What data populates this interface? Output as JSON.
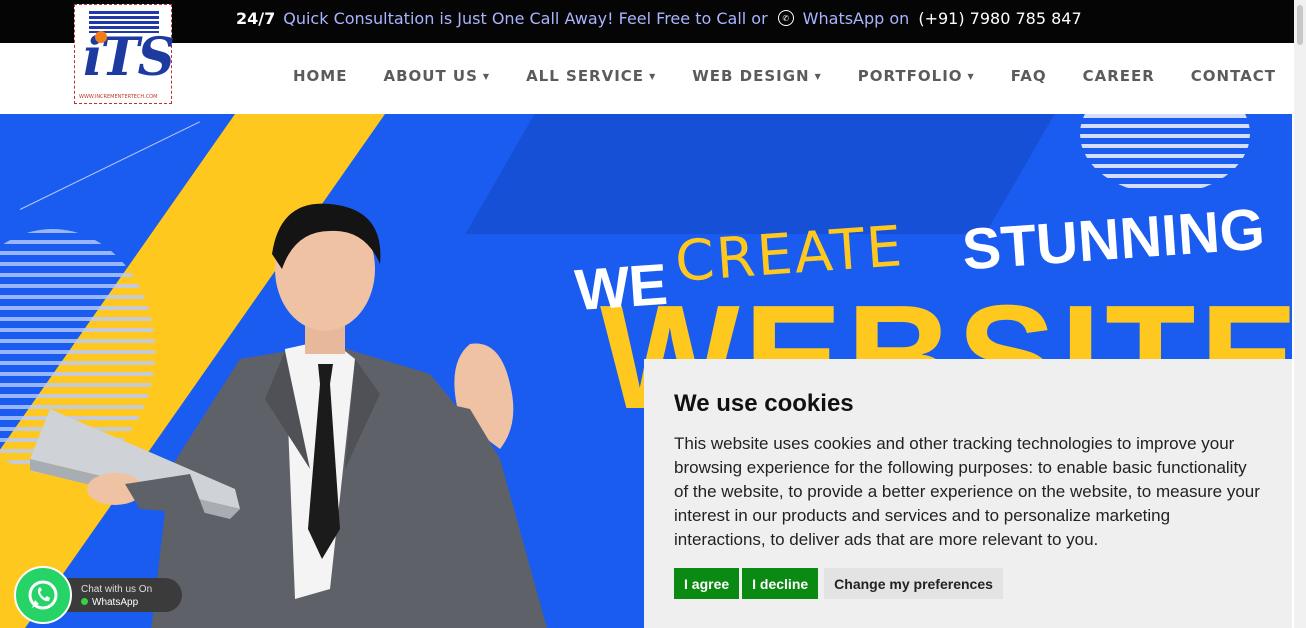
{
  "topbar": {
    "hours": "24/7",
    "message": "Quick Consultation is Just One Call Away! Feel Free to Call or",
    "whatsapp_label": "WhatsApp on",
    "phone": "(+91) 7980 785 847"
  },
  "logo": {
    "letters": "iTS",
    "tagline": "WWW.INCREMENTERTECH.COM"
  },
  "nav": {
    "items": [
      {
        "label": "HOME",
        "dropdown": false
      },
      {
        "label": "ABOUT US",
        "dropdown": true
      },
      {
        "label": "ALL SERVICE",
        "dropdown": true
      },
      {
        "label": "WEB DESIGN",
        "dropdown": true
      },
      {
        "label": "PORTFOLIO",
        "dropdown": true
      },
      {
        "label": "FAQ",
        "dropdown": false
      },
      {
        "label": "CAREER",
        "dropdown": false
      },
      {
        "label": "CONTACT",
        "dropdown": false
      }
    ]
  },
  "hero": {
    "we": "WE",
    "create": "CREATE",
    "stunning": "STUNNING",
    "websites": "WEBSITES"
  },
  "cookie": {
    "title": "We use cookies",
    "body": "This website uses cookies and other tracking technologies to improve your browsing experience for the following purposes: to enable basic functionality of the website, to provide a better experience on the website, to measure your interest in our products and services and to personalize marketing interactions, to deliver ads that are more relevant to you.",
    "agree": "I agree",
    "decline": "I decline",
    "preferences": "Change my preferences"
  },
  "whatsapp_widget": {
    "line1": "Chat with us On",
    "line2": "WhatsApp"
  },
  "colors": {
    "hero_blue": "#1a5cf0",
    "accent_yellow": "#ffc81e",
    "button_green": "#0a8a12"
  }
}
